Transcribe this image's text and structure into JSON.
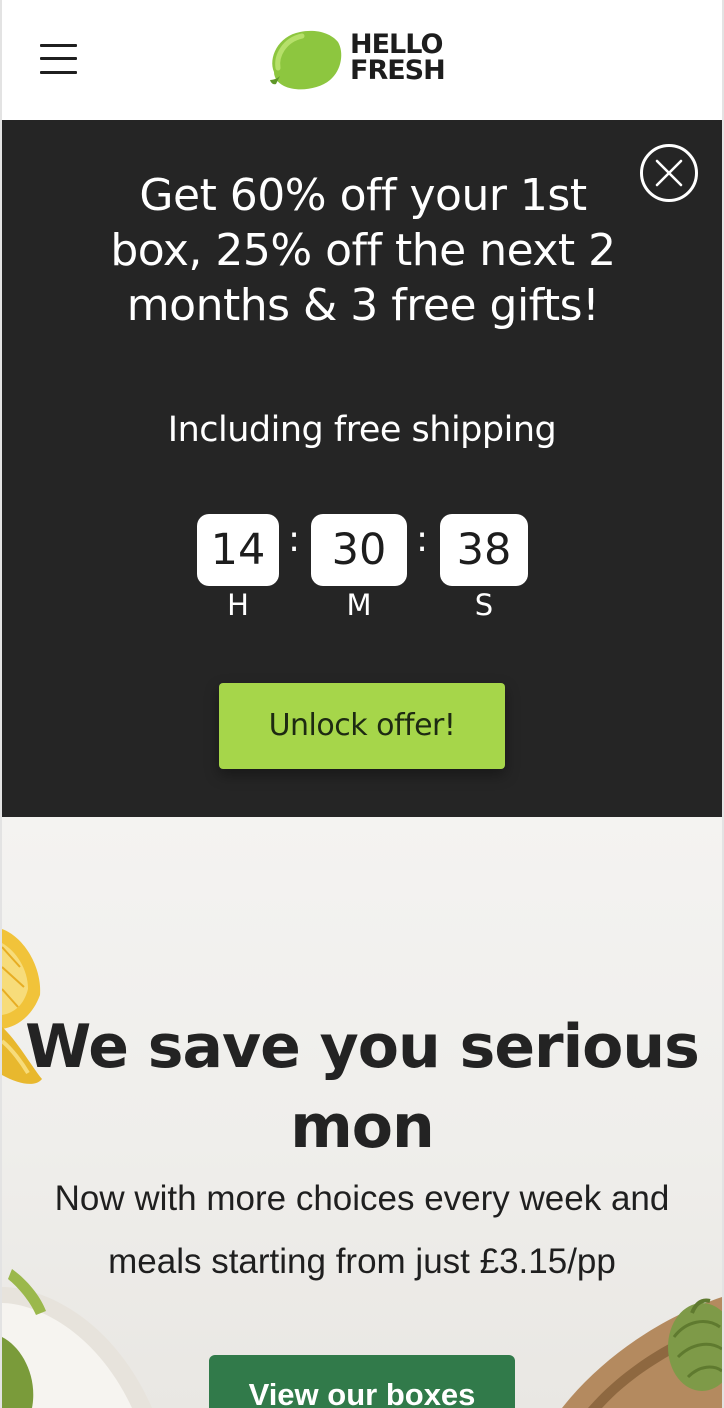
{
  "header": {
    "menu_icon": "hamburger-menu-icon",
    "logo": {
      "line1": "HELLO",
      "line2": "FRESH",
      "brand_color": "#8dc63f"
    }
  },
  "promo": {
    "title": "Get 60% off your 1st box, 25% off the next 2 months & 3 free gifts!",
    "subtitle": "Including free shipping",
    "close_icon": "close-circle-icon",
    "timer": {
      "hours": "14",
      "minutes": "30",
      "seconds": "38",
      "hours_unit": "H",
      "minutes_unit": "M",
      "seconds_unit": "S",
      "separator": ":"
    },
    "cta_label": "Unlock offer!",
    "background_color": "#252525",
    "cta_color": "#a6d64a"
  },
  "hero": {
    "title": "We save you serious mon",
    "subtitle": "Now with more choices every week and meals starting from just £3.15/pp",
    "cta_label": "View our boxes",
    "cta_color": "#317a4a"
  }
}
